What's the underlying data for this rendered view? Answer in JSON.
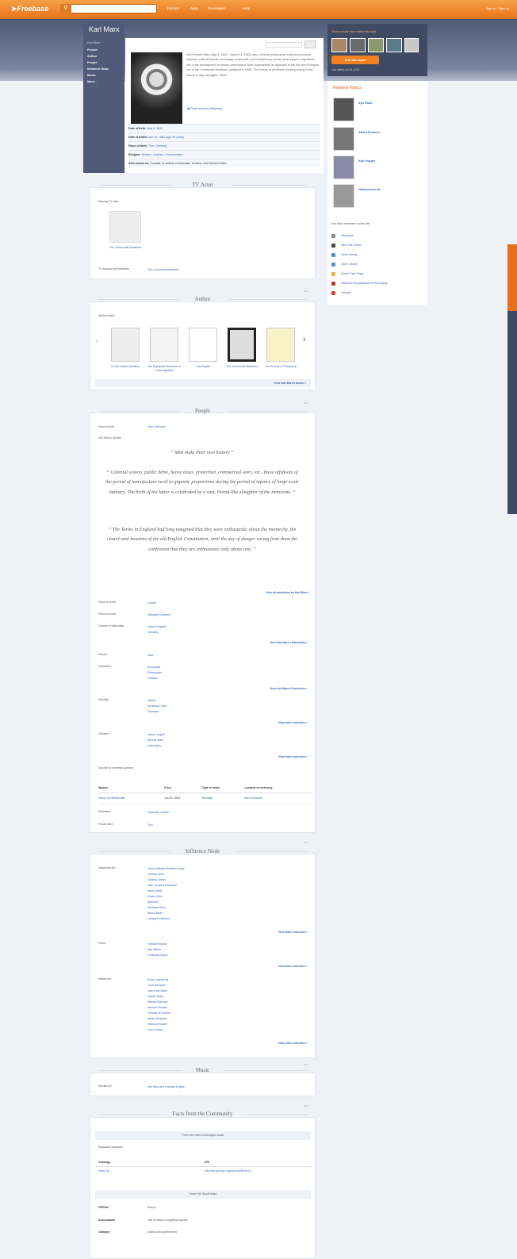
{
  "topbar": {
    "logo": "Freebase",
    "nav": [
      "Explore",
      "Apps",
      "Developers",
      "Help"
    ],
    "signin": "Sign in / Sign up"
  },
  "page_title": "Karl Marx",
  "left_nav": {
    "heading": "Karl Marx",
    "items": [
      "Person",
      "Author",
      "People",
      "Influence Node",
      "Music",
      "More..."
    ]
  },
  "card": {
    "intro": "Karl Heinrich Marx (May 5, 1818 – March 14, 1883) was a German philosopher, political economist, historian, political theorist, sociologist, communist, and revolutionary, whose ideas played a significant role in the development of modern communism. Marx summarized his approach to the first line of chapter one of the Communist Manifesto, published in 1848: \"The history of all hitherto existing society is the history of class struggles.\" More ...",
    "wikipedia": "Read article at Wikipedia",
    "facts": [
      {
        "label": "Date of birth:",
        "value": "May 5, 1818"
      },
      {
        "label": "Date of death:",
        "value": "Mar 14, 1883 (age 64 years)"
      },
      {
        "label": "Place of birth:",
        "value": "Trier, Germany"
      },
      {
        "label": "Religion:",
        "value": "Atheism, Judaism, Protestantism"
      },
      {
        "label": "Also known as:",
        "value": "Founder of modern communism, Al Moor, Karl Heinrich Marx"
      }
    ]
  },
  "people_edited": {
    "label": "These people have edited this topic",
    "button": "Edit this topic",
    "updated": "Last edited Jan 25, 2012"
  },
  "related": {
    "title": "Related Topics",
    "items": [
      "Ayn Rand",
      "Albert Einstein",
      "Karl Popper",
      "Hannah Arendt"
    ],
    "ext_label": "Karl Marx elsewhere on the web",
    "links": [
      "Wikipedia",
      "New York Times",
      "Open Library",
      "Open Library",
      "Quote Topic Page",
      "Stanford Encyclopedia of Philosophy",
      "Youtube"
    ]
  },
  "tv_actor": {
    "title": "TV Actor",
    "starring_label": "Starring TV roles",
    "role_title": "The Communist Manifesto",
    "episodes_label": "TV episode performances",
    "episodes_value": "The Communist Manifesto",
    "top": "Top ↑"
  },
  "author": {
    "title": "Author",
    "works_label": "Works written",
    "books": [
      "On the Jewish Question",
      "The Eighteenth Brumaire of Louis Napoleon",
      "Das Kapital",
      "The Communist Manifesto",
      "The Poverty of Philosophy"
    ],
    "more": "View Karl Marx's books »",
    "top": "Top ↑"
  },
  "people": {
    "title": "People",
    "place_label": "Place of birth:",
    "place_value": "Trier, Germany",
    "quotes_label": "Karl Marx's Quotes",
    "quotes": [
      "“ Men make their own history ”",
      "“ Colonial system, public debts, heavy taxes, protection, commercial wars, etc., these offshoots of the period of manufacture swell to gigantic proportions during the period of infancy of large-scale industry. The birth of the latter is celebrated by a vast, Herod-like slaughter of the innocents. ”",
      "“ The Tories in England had long imagined that they were enthusiastic about the monarchy, the church and beauties of the old English Constitution, until the day of danger wrung from them the confession that they are enthusiastic only about rent. ”"
    ],
    "quotes_more": "View all quotations by Karl Marx »",
    "death_label": "Place of death:",
    "death_value": "London",
    "burial_label": "Place of burial:",
    "burial_value": "Highgate Cemetery",
    "nationality_label": "Country of nationality:",
    "nationality_values": [
      "United Kingdom",
      "Germany"
    ],
    "nationality_more": "View Karl Marx's Nationality »",
    "gender_label": "Gender:",
    "gender_value": "Male",
    "profession_label": "Profession:",
    "profession_values": [
      "Economist",
      "Philosopher",
      "Politician"
    ],
    "profession_more": "View Karl Marx's Profession »",
    "ethnicity_label": "Ethnicity:",
    "ethnicity_values": [
      "Jewish",
      "Ashkenazi Jews",
      "Germans"
    ],
    "ethnicity_more": "View entire collection »",
    "children_label": "Children:",
    "children_values": [
      "Jenny Longuet",
      "Eleanor Marx",
      "Laura Marx"
    ],
    "children_more": "View entire collection »",
    "spouse_label": "Spouse (or domestic partner):",
    "spouse_headers": [
      "Spouse",
      "From",
      "Type of union",
      "Location of ceremony"
    ],
    "spouse_row": [
      "Jenny von Westphalen",
      "Jun 19, 1843",
      "Marriage",
      "Bad Kreuznach"
    ],
    "education_label": "Education:",
    "education_value": "University of Bonn",
    "places_label": "Places lived:",
    "places_value": "Trier",
    "top": "Top ↑"
  },
  "influence": {
    "title": "Influence Node",
    "by_label": "Influenced By:",
    "by_values": [
      "Georg Wilhelm Friedrich Hegel",
      "Thomas More",
      "Charles Darwin",
      "Jean-Jacques Rousseau",
      "Adam Smith",
      "Moses Hess",
      "Epicurus",
      "Immanuel Kant",
      "Bruno Bauer",
      "Ludwig Feuerbach"
    ],
    "by_more": "View entire collection »",
    "peers_label": "Peers:",
    "peers_values": [
      "Friedrich Engels",
      "Max Stirner",
      "Frederick Engels"
    ],
    "peers_more": "View entire collection »",
    "inf_label": "Influenced:",
    "inf_values": [
      "Rosa Luxemburg",
      "Louis Althusser",
      "Jean-Paul Sartre",
      "Joseph Stalin",
      "Herbert Marcuse",
      "Antonio Gramsci",
      "Theodor W. Adorno",
      "Walter Benjamin",
      "Edmund Husserl",
      "Leon Trotsky"
    ],
    "inf_more": "View entire collection »",
    "top": "Top ↑"
  },
  "music": {
    "title": "Music",
    "member_label": "Member of:",
    "member_value": "Karl Marx and Friedrich Engels",
    "top": "Top ↑"
  },
  "community": {
    "title": "Facts from the Community",
    "band1": "From the Web Ontologies base",
    "equiv_label": "Equivalent instances:",
    "ont_headers": [
      "Ontology",
      "URI"
    ],
    "ont_row": [
      "OpenCyc",
      "http://sw.opencyc.org/concept/Mx4rvVj..."
    ],
    "band2": "From the Scroll base",
    "rows": [
      {
        "label": "PWPSet",
        "value": "Prasco"
      },
      {
        "label": "Descendants",
        "value": "One of history's significant figures"
      },
      {
        "label": "Category",
        "value": "political and government"
      }
    ]
  }
}
